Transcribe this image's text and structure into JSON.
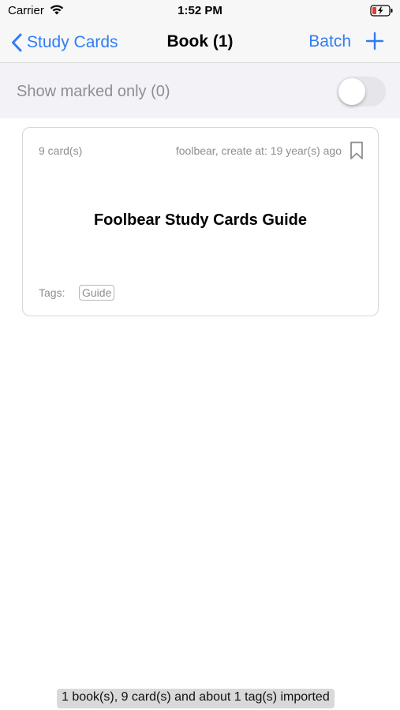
{
  "status_bar": {
    "carrier": "Carrier",
    "time": "1:52 PM",
    "wifi_icon": "wifi-icon",
    "battery_icon": "battery-charging-icon"
  },
  "nav": {
    "back_label": "Study Cards",
    "back_icon": "chevron-left-icon",
    "title": "Book (1)",
    "batch_label": "Batch",
    "add_icon": "plus-icon",
    "accent_color": "#2f7cf6"
  },
  "filter": {
    "label": "Show marked only (0)",
    "toggle_on": false
  },
  "books": [
    {
      "card_count": "9 card(s)",
      "meta": "foolbear, create at: 19 year(s) ago",
      "bookmark_icon": "bookmark-icon",
      "title": "Foolbear Study Cards Guide",
      "tags_label": "Tags:",
      "tags": [
        "Guide"
      ]
    }
  ],
  "toast": "1 book(s), 9 card(s) and about 1 tag(s) imported"
}
